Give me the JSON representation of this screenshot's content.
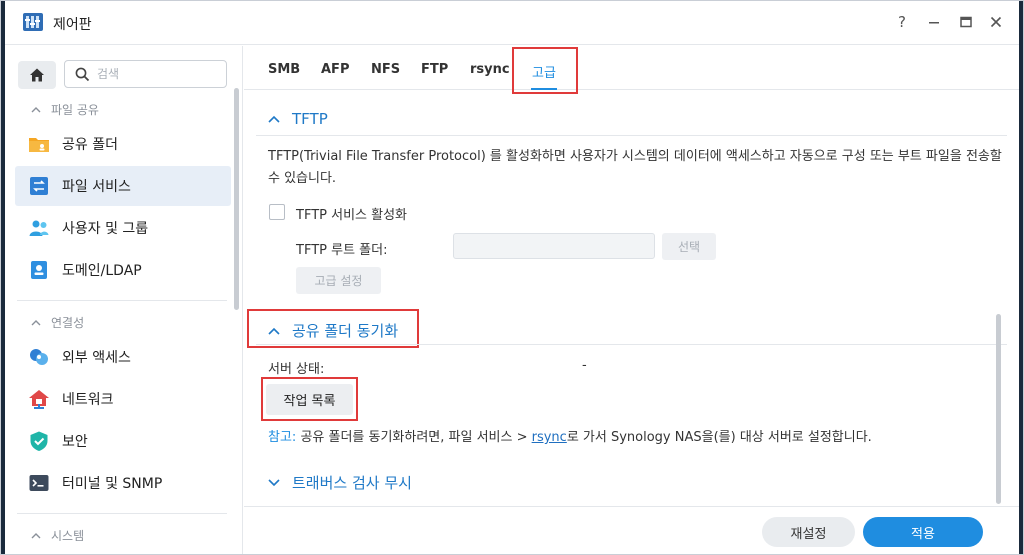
{
  "window": {
    "title": "제어판"
  },
  "titlebar": {
    "help": "?",
    "minimize": "–",
    "maximize": "▭",
    "close": "✕"
  },
  "sidebar": {
    "search_placeholder": "검색",
    "sections": [
      {
        "label": "파일 공유",
        "items": [
          {
            "label": "공유 폴더",
            "icon": "folder-icon"
          },
          {
            "label": "파일 서비스",
            "icon": "file-service-icon",
            "active": true
          },
          {
            "label": "사용자 및 그룹",
            "icon": "users-icon"
          },
          {
            "label": "도메인/LDAP",
            "icon": "domain-icon"
          }
        ]
      },
      {
        "label": "연결성",
        "items": [
          {
            "label": "외부 액세스",
            "icon": "external-access-icon"
          },
          {
            "label": "네트워크",
            "icon": "network-icon"
          },
          {
            "label": "보안",
            "icon": "shield-icon"
          },
          {
            "label": "터미널 및 SNMP",
            "icon": "terminal-icon"
          }
        ]
      },
      {
        "label": "시스템"
      }
    ]
  },
  "tabs": [
    "SMB",
    "AFP",
    "NFS",
    "FTP",
    "rsync",
    "고급"
  ],
  "active_tab": "고급",
  "tftp": {
    "heading": "TFTP",
    "description": "TFTP(Trivial File Transfer Protocol) 를 활성화하면 사용자가 시스템의 데이터에 액세스하고 자동으로 구성 또는 부트 파일을 전송할 수 있습니다.",
    "enable_label": "TFTP 서비스 활성화",
    "root_label": "TFTP 루트 폴더:",
    "select_button": "선택",
    "advanced_button": "고급 설정"
  },
  "sync": {
    "heading": "공유 폴더 동기화",
    "server_status_label": "서버 상태:",
    "server_status_value": "-",
    "task_list_button": "작업 목록",
    "note_prefix": "참고:",
    "note_text_1": " 공유 폴더를 동기화하려면, 파일 서비스 > ",
    "note_link": "rsync",
    "note_text_2": "로 가서 Synology NAS을(를) 대상 서버로 설정합니다."
  },
  "bypass": {
    "heading": "트래버스 검사 무시"
  },
  "footer": {
    "reset": "재설정",
    "apply": "적용"
  },
  "colors": {
    "accent": "#1f8de0",
    "highlight_box": "#e03a3a",
    "active_item_bg": "#e7eef7"
  }
}
